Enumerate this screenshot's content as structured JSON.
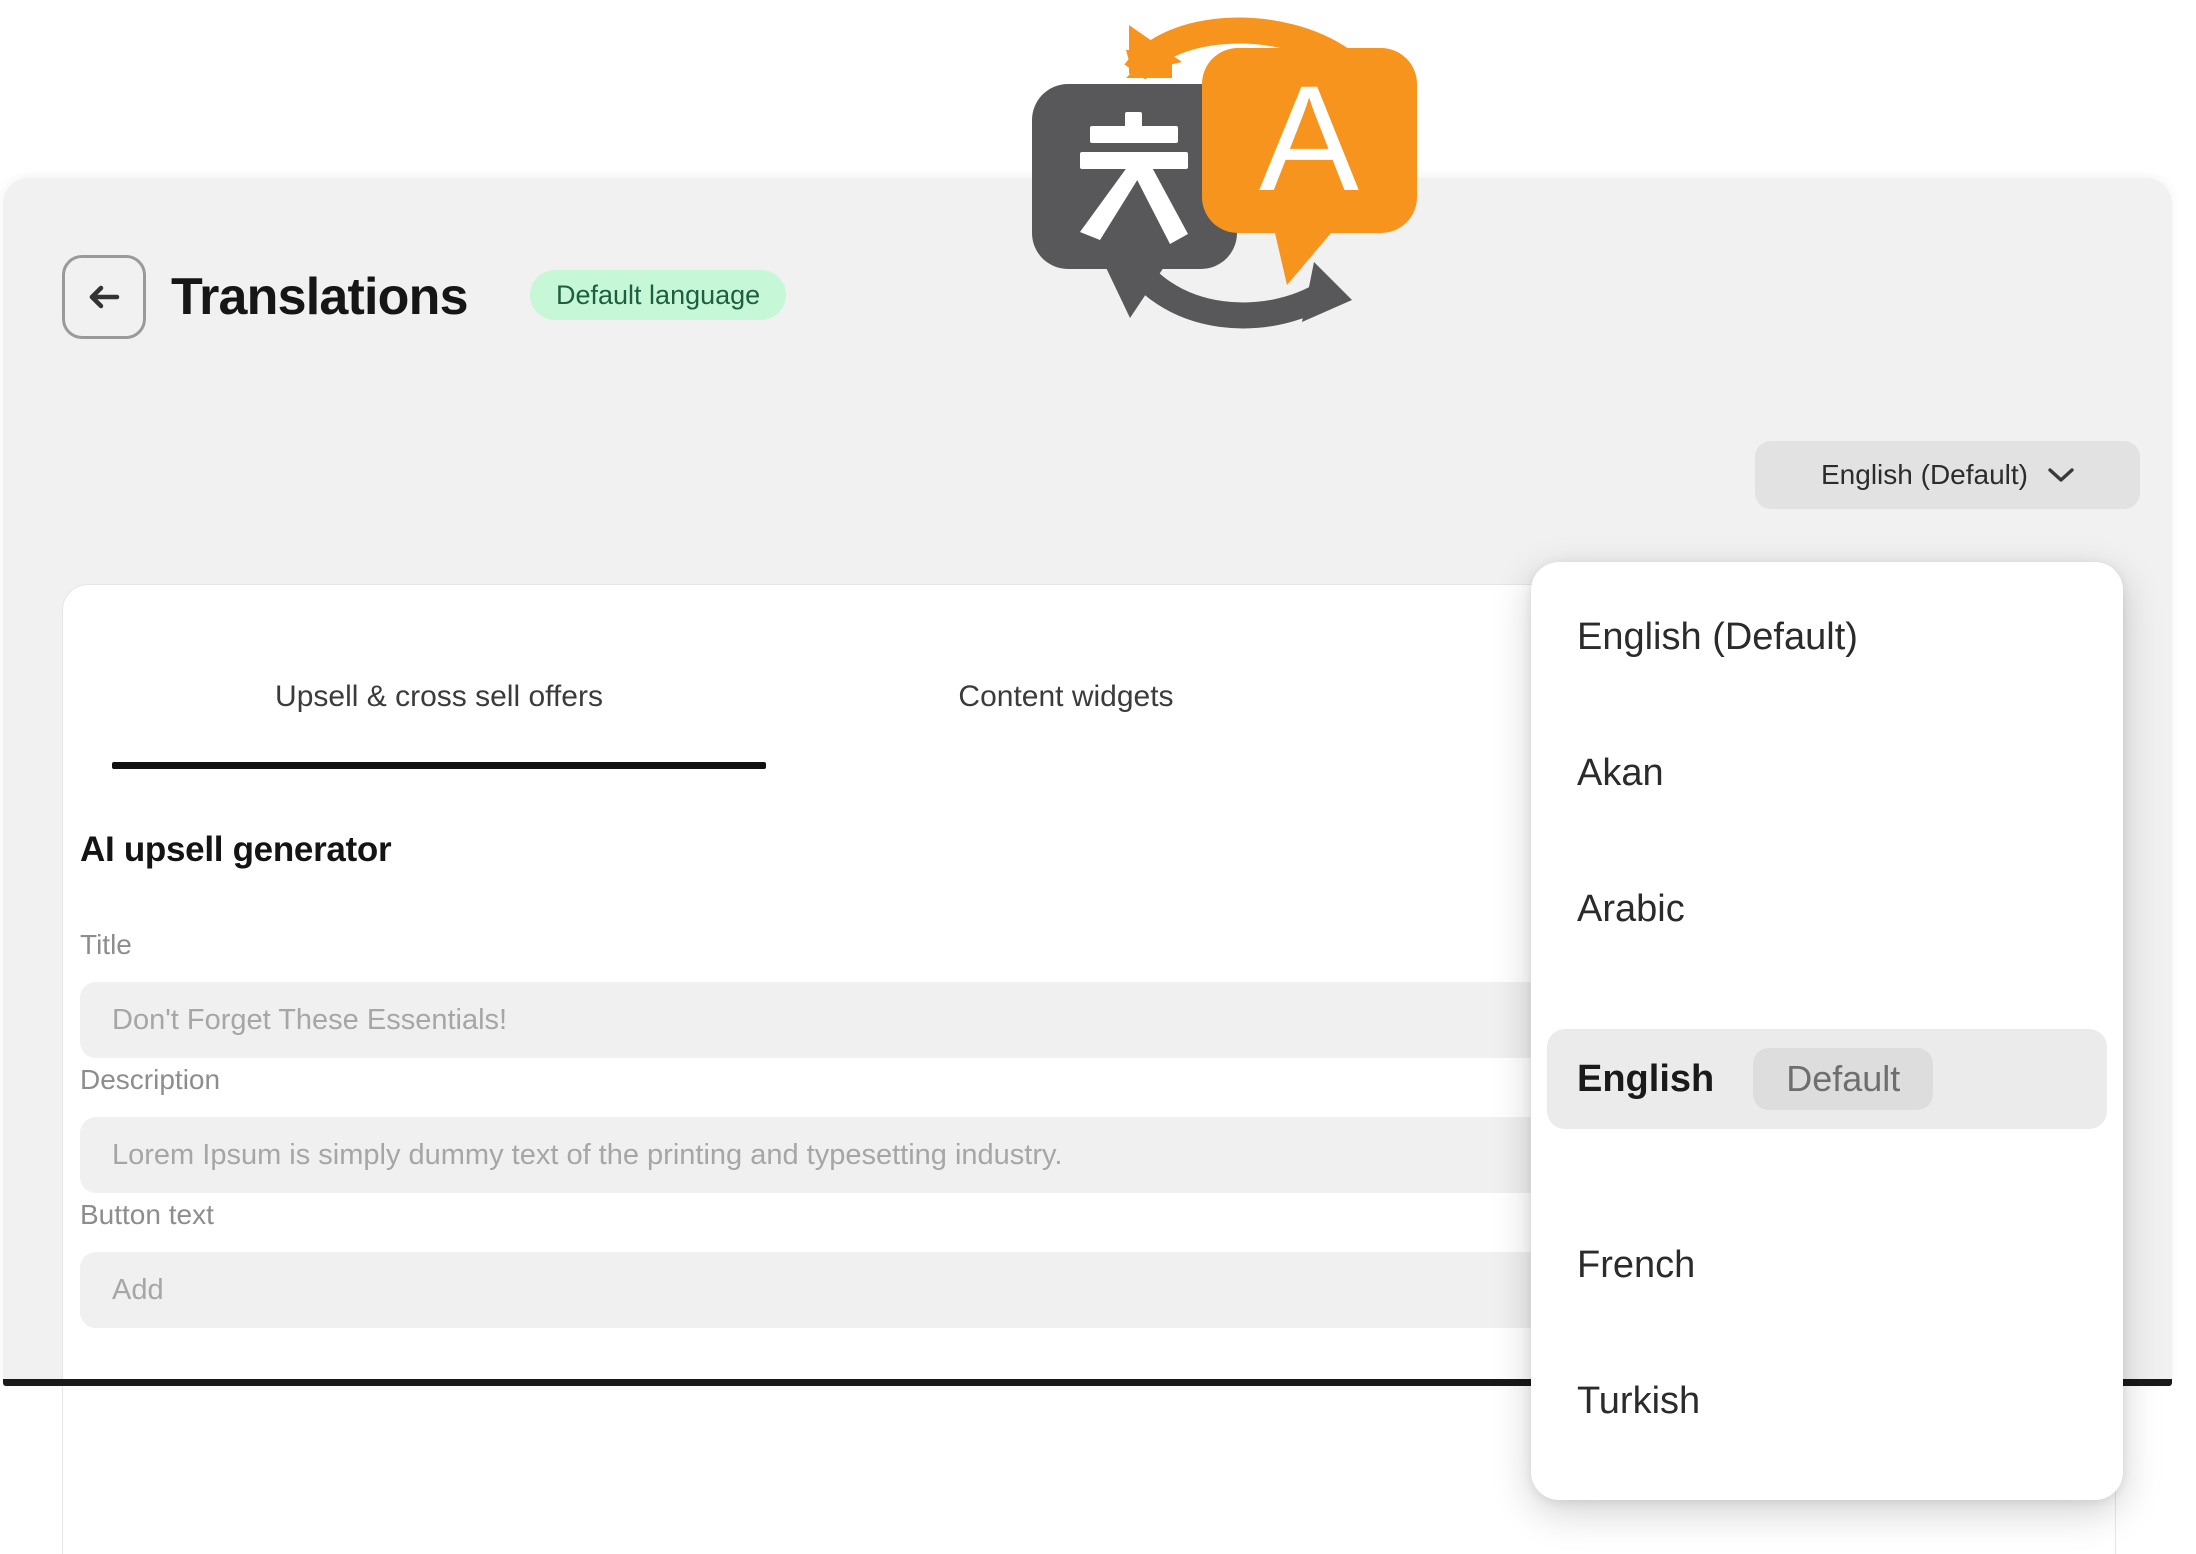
{
  "header": {
    "back_icon": "arrow-left-icon",
    "title": "Translations",
    "badge": "Default language"
  },
  "language_selector": {
    "selected": "English (Default)",
    "chevron_icon": "chevron-down-icon"
  },
  "tabs": [
    {
      "label": "Upsell & cross sell offers",
      "active": true
    },
    {
      "label": "Content widgets",
      "active": false
    }
  ],
  "section": {
    "heading": "AI upsell generator"
  },
  "fields": [
    {
      "label": "Title",
      "placeholder": "Don't Forget These Essentials!",
      "value": ""
    },
    {
      "label": "Description",
      "placeholder": "Lorem Ipsum is simply dummy text of the printing and typesetting industry.",
      "value": ""
    },
    {
      "label": "Button text",
      "placeholder": "Add",
      "value": ""
    }
  ],
  "dropdown": {
    "items": [
      {
        "label": "English (Default)",
        "badge": "",
        "selected": false
      },
      {
        "label": "Akan",
        "badge": "",
        "selected": false
      },
      {
        "label": "Arabic",
        "badge": "",
        "selected": false
      },
      {
        "label": "English",
        "badge": "Default",
        "selected": true
      },
      {
        "label": "French",
        "badge": "",
        "selected": false
      },
      {
        "label": "Turkish",
        "badge": "",
        "selected": false
      }
    ]
  },
  "decorative": {
    "translate_icon": "translate-icon",
    "translate_icon_char_source": "文",
    "translate_icon_char_target": "A"
  },
  "colors": {
    "badge_bg": "#c6f7d6",
    "badge_text": "#1d5f41",
    "page_bg": "#f1f1f1",
    "card_bg": "#ffffff",
    "input_bg": "#f0f0f0",
    "tab_underline": "#111111",
    "icon_orange": "#f7941d",
    "icon_gray": "#58585a"
  }
}
